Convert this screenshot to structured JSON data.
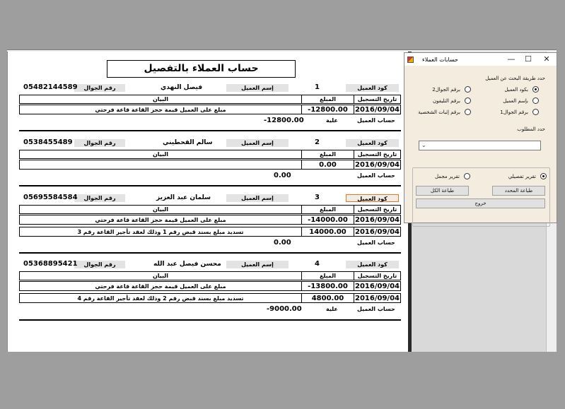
{
  "report": {
    "title": "حساب العملاء بالتفصيل",
    "labels": {
      "customer_code": "كود العميل",
      "customer_name": "إسم العميل",
      "mobile": "رقم الجوال",
      "reg_date": "تاريخ التسجيل",
      "amount": "المبلغ",
      "statement": "البيان",
      "customer_account": "حساب العميل",
      "balance_owed": "علية"
    },
    "customers": [
      {
        "code": "1",
        "name": "فيصل النهدي",
        "mobile": "05482144589",
        "rows": [
          {
            "date": "2016/09/04",
            "amount": "-12800.00",
            "statement": "مبلغ على العميل قيمة حجز القاعة قاعة فرحتي"
          }
        ],
        "balance_note": "علية",
        "balance": "-12800.00"
      },
      {
        "code": "2",
        "name": "سالم القحطيني",
        "mobile": "0538455489",
        "rows": [
          {
            "date": "2016/09/04",
            "amount": "0.00",
            "statement": ""
          }
        ],
        "balance_note": "",
        "balance": "0.00"
      },
      {
        "code": "3",
        "name": "سلمان عبد العزيز",
        "mobile": "05695584584",
        "rows": [
          {
            "date": "2016/09/04",
            "amount": "-14000.00",
            "statement": "مبلغ على العميل قيمة حجز القاعة قاعة فرحتي"
          },
          {
            "date": "2016/09/04",
            "amount": "14000.00",
            "statement": "تسديد مبلغ بسند قبض رقم 1 وذلك لعقد تأجير القاعة رقم 3"
          }
        ],
        "balance_note": "",
        "balance": "0.00"
      },
      {
        "code": "4",
        "name": "محسن فيصل عبد الله",
        "mobile": "05368895421",
        "rows": [
          {
            "date": "2016/09/04",
            "amount": "-13800.00",
            "statement": "مبلغ على العميل قيمة حجز القاعة قاعة فرحتي"
          },
          {
            "date": "2016/09/04",
            "amount": "4800.00",
            "statement": "تسديد مبلغ بسند قبض رقم 2 وذلك لعقد تأجير القاعة رقم 4"
          }
        ],
        "balance_note": "علية",
        "balance": "-9000.00"
      }
    ]
  },
  "dialog": {
    "title": "حسابات العملاء",
    "controls": {
      "minimize": "—",
      "maximize": "☐",
      "close": "✕"
    },
    "search_method_label": "حدد طريقة البحث عن العميل",
    "search_options": [
      {
        "label": "بكود العميل",
        "checked": true
      },
      {
        "label": "برقم الجوال2",
        "checked": false
      },
      {
        "label": "بإسم العميل",
        "checked": false
      },
      {
        "label": "برقم التليفون",
        "checked": false
      },
      {
        "label": "برقم الجوال1",
        "checked": false
      },
      {
        "label": "برقم إثبات الشخصية",
        "checked": false
      }
    ],
    "required_label": "حدد المطلوب",
    "combo_value": "",
    "report_options": [
      {
        "label": "تقرير تفصيلي",
        "checked": true
      },
      {
        "label": "تقرير مجمل",
        "checked": false
      }
    ],
    "buttons": {
      "print_selected": "طباعة المحدد",
      "print_all": "طباعة الكل",
      "exit": "خروج"
    }
  }
}
